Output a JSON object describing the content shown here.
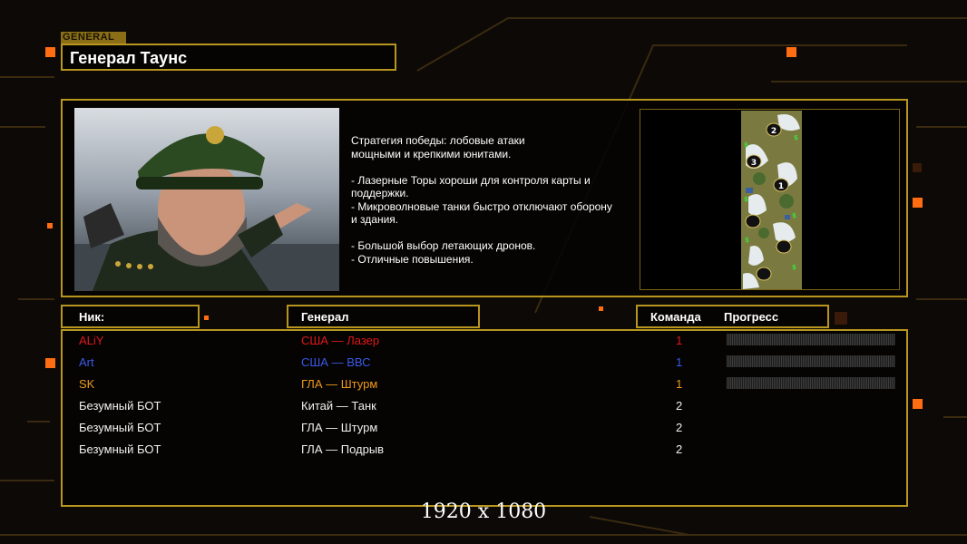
{
  "general": {
    "tag": "GENERAL",
    "name": "Генерал Таунс",
    "description": "Стратегия победы: лобовые атаки\nмощными и крепкими юнитами.\n\n- Лазерные Торы хороши для контроля карты и\n  поддержки.\n- Микроволновые танки быстро отключают оборону\n  и здания.\n\n- Большой выбор летающих дронов.\n- Отличные повышения."
  },
  "map": {
    "spawns": [
      "2",
      "3",
      "1"
    ]
  },
  "table": {
    "headers": {
      "nick": "Ник:",
      "general": "Генерал",
      "team": "Команда",
      "progress": "Прогресс"
    },
    "rows": [
      {
        "nick": "ALiY",
        "general": "США — Лазер",
        "team": "1",
        "color": "#e01818",
        "progress": 0
      },
      {
        "nick": "Art",
        "general": "США — ВВС",
        "team": "1",
        "color": "#3a5ae8",
        "progress": 0
      },
      {
        "nick": "SK",
        "general": "ГЛА — Штурм",
        "team": "1",
        "color": "#f09a1a",
        "progress": 0
      },
      {
        "nick": "Безумный БОТ",
        "general": "Китай — Танк",
        "team": "2",
        "color": "#f0f0f0"
      },
      {
        "nick": "Безумный БОТ",
        "general": "ГЛА — Штурм",
        "team": "2",
        "color": "#f0f0f0"
      },
      {
        "nick": "Безумный БОТ",
        "general": "ГЛА — Подрыв",
        "team": "2",
        "color": "#f0f0f0"
      }
    ]
  },
  "resolution": "1920 x 1080",
  "colors": {
    "accent": "#b8951f",
    "background": "#0c0906",
    "glow": "#ff7a10"
  }
}
